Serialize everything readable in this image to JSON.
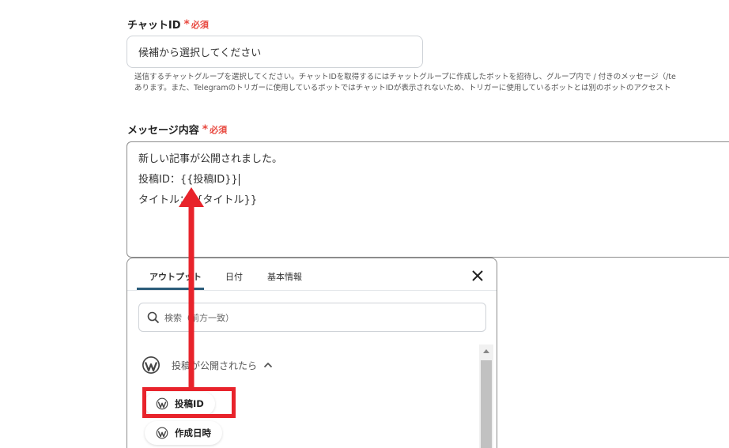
{
  "chat_id": {
    "label": "チャットID",
    "required_label": "必須",
    "placeholder": "候補から選択してください",
    "help_line1": "送信するチャットグループを選択してください。チャットIDを取得するにはチャットグループに作成したボットを招待し、グループ内で / 付きのメッセージ（/te",
    "help_line2": "あります。また、Telegramのトリガーに使用しているボットではチャットIDが表示されないため、トリガーに使用しているボットとは別のボットのアクセスト"
  },
  "message": {
    "label": "メッセージ内容",
    "required_label": "必須",
    "lines": [
      "新しい記事が公開されました。",
      "投稿ID：{{投稿ID}}",
      "タイトル：{{タイトル}}"
    ]
  },
  "picker": {
    "tabs": [
      "アウトプット",
      "日付",
      "基本情報"
    ],
    "active_tab": 0,
    "search_placeholder": "検索（前方一致）",
    "group_label": "投稿が公開されたら",
    "items": [
      "投稿ID",
      "作成日時"
    ]
  },
  "colors": {
    "required": "#e8483f",
    "annotation": "#e8232b",
    "tab_accent": "#2b5c7a"
  }
}
